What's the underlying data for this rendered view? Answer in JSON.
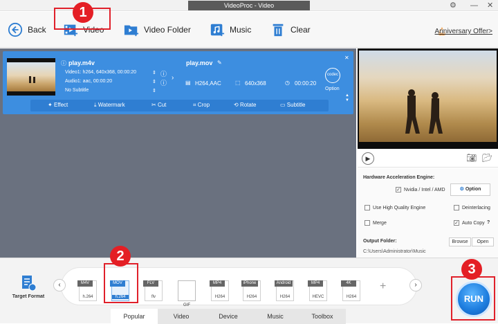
{
  "window": {
    "title": "VideoProc - Video"
  },
  "toolbar": {
    "back": "Back",
    "video": "Video",
    "video_folder": "Video Folder",
    "music": "Music",
    "clear": "Clear",
    "anniversary": "Anniversary Offer>"
  },
  "badges": {
    "one": "1",
    "two": "2",
    "three": "3"
  },
  "clip": {
    "source_name": "play.m4v",
    "video_info": "Video1: h264, 640x368, 00:00:20",
    "audio_info": "Audio1: aac, 00:00:20",
    "subtitle": "No Subtitle",
    "output_name": "play.mov",
    "codec": "H264,AAC",
    "resolution": "640x368",
    "duration": "00:00:20",
    "option_label": "Option",
    "codec_label": "codec"
  },
  "edit": {
    "effect": "Effect",
    "watermark": "Watermark",
    "cut": "Cut",
    "crop": "Crop",
    "rotate": "Rotate",
    "subtitle": "Subtitle"
  },
  "settings": {
    "hw_title": "Hardware Acceleration Engine:",
    "nvidia": "Nvidia / Intel / AMD",
    "option_btn": "Option",
    "hq_engine": "Use High Quality Engine",
    "deinterlacing": "Deinterlacing",
    "merge": "Merge",
    "auto_copy": "Auto Copy",
    "help": "?",
    "output_folder": "Output Folder:",
    "browse": "Browse",
    "open": "Open",
    "folder_path": "C:\\Users\\Administrator\\Music"
  },
  "target_format": "Target Format",
  "formats": [
    {
      "tag": "M4V",
      "sub": "h.264",
      "label": ""
    },
    {
      "tag": "MOV",
      "sub": "h.264",
      "label": ""
    },
    {
      "tag": "FLV",
      "sub": "flv",
      "label": ""
    },
    {
      "tag": "",
      "sub": "",
      "label": "GIF"
    },
    {
      "tag": "MP4",
      "sub": "",
      "label": "H264"
    },
    {
      "tag": "iPhone",
      "sub": "",
      "label": "H264"
    },
    {
      "tag": "Android",
      "sub": "",
      "label": "H264"
    },
    {
      "tag": "MP4",
      "sub": "",
      "label": "HEVC"
    },
    {
      "tag": "4K",
      "sub": "",
      "label": "H264"
    }
  ],
  "tabs": [
    "Popular",
    "Video",
    "Device",
    "Music",
    "Toolbox"
  ],
  "run": "RUN",
  "colors": {
    "accent": "#3d8ee0",
    "highlight": "#e0202a",
    "run": "#1f7fe0"
  }
}
